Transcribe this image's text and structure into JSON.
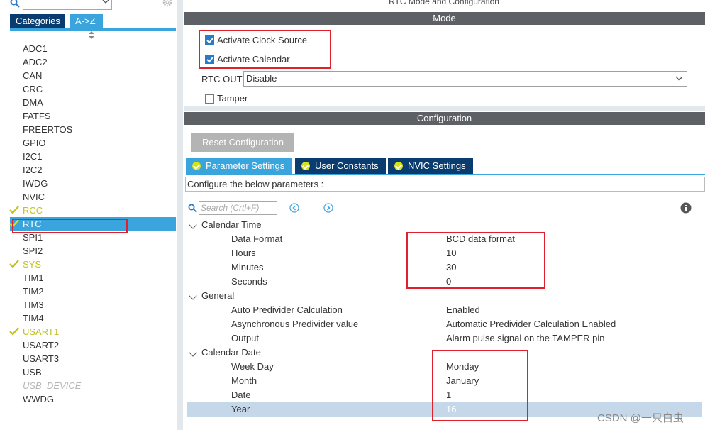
{
  "left": {
    "tabs": {
      "categories": "Categories",
      "az": "A->Z"
    },
    "items": [
      {
        "label": "ADC1",
        "state": "normal"
      },
      {
        "label": "ADC2",
        "state": "normal"
      },
      {
        "label": "CAN",
        "state": "normal"
      },
      {
        "label": "CRC",
        "state": "normal"
      },
      {
        "label": "DMA",
        "state": "normal"
      },
      {
        "label": "FATFS",
        "state": "normal"
      },
      {
        "label": "FREERTOS",
        "state": "normal"
      },
      {
        "label": "GPIO",
        "state": "normal"
      },
      {
        "label": "I2C1",
        "state": "normal"
      },
      {
        "label": "I2C2",
        "state": "normal"
      },
      {
        "label": "IWDG",
        "state": "normal"
      },
      {
        "label": "NVIC",
        "state": "normal"
      },
      {
        "label": "RCC",
        "state": "enabled"
      },
      {
        "label": "RTC",
        "state": "selected"
      },
      {
        "label": "SPI1",
        "state": "normal"
      },
      {
        "label": "SPI2",
        "state": "normal"
      },
      {
        "label": "SYS",
        "state": "enabled"
      },
      {
        "label": "TIM1",
        "state": "normal"
      },
      {
        "label": "TIM2",
        "state": "normal"
      },
      {
        "label": "TIM3",
        "state": "normal"
      },
      {
        "label": "TIM4",
        "state": "normal"
      },
      {
        "label": "USART1",
        "state": "enabled"
      },
      {
        "label": "USART2",
        "state": "normal"
      },
      {
        "label": "USART3",
        "state": "normal"
      },
      {
        "label": "USB",
        "state": "normal"
      },
      {
        "label": "USB_DEVICE",
        "state": "disabled"
      },
      {
        "label": "WWDG",
        "state": "normal"
      }
    ]
  },
  "right": {
    "title": "RTC Mode and Configuration",
    "mode_bar": "Mode",
    "activate_clock": "Activate Clock Source",
    "activate_calendar": "Activate Calendar",
    "rtc_out_label": "RTC OUT",
    "rtc_out_value": "Disable",
    "tamper": "Tamper",
    "config_bar": "Configuration",
    "reset_button": "Reset Configuration",
    "tabs": [
      "Parameter Settings",
      "User Constants",
      "NVIC Settings"
    ],
    "configure_text": "Configure the below parameters :",
    "search_placeholder": "Search (Crtl+F)",
    "params": [
      {
        "kind": "group",
        "name": "Calendar Time"
      },
      {
        "kind": "param",
        "name": "Data Format",
        "value": "BCD data format"
      },
      {
        "kind": "param",
        "name": "Hours",
        "value": "10"
      },
      {
        "kind": "param",
        "name": "Minutes",
        "value": "30"
      },
      {
        "kind": "param",
        "name": "Seconds",
        "value": "0"
      },
      {
        "kind": "group",
        "name": "General"
      },
      {
        "kind": "param",
        "name": "Auto Predivider Calculation",
        "value": "Enabled"
      },
      {
        "kind": "param",
        "name": "Asynchronous Predivider value",
        "value": "Automatic Predivider Calculation Enabled"
      },
      {
        "kind": "param",
        "name": "Output",
        "value": "Alarm pulse signal on the TAMPER pin"
      },
      {
        "kind": "group",
        "name": "Calendar Date"
      },
      {
        "kind": "param",
        "name": "Week Day",
        "value": "Monday"
      },
      {
        "kind": "param",
        "name": "Month",
        "value": "January"
      },
      {
        "kind": "param",
        "name": "Date",
        "value": "1"
      },
      {
        "kind": "param",
        "name": "Year",
        "value": "16",
        "selected": true
      }
    ]
  },
  "watermark": "CSDN @一只白虫",
  "colors": {
    "accent": "#3aa4dc",
    "dark_tab": "#0b3c6f",
    "enabled_text": "#c2c31e",
    "highlight": "#e0202a"
  }
}
